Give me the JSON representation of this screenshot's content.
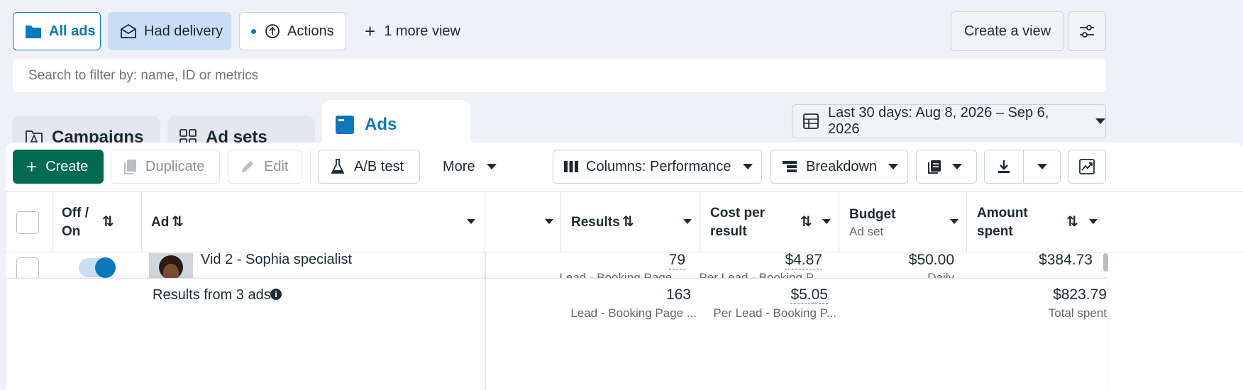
{
  "views": {
    "all_ads": "All ads",
    "had_delivery": "Had delivery",
    "actions": "Actions",
    "more_view": "1 more view",
    "create_view": "Create a view"
  },
  "search": {
    "placeholder": "Search to filter by: name, ID or metrics"
  },
  "tabs": {
    "campaigns": "Campaigns",
    "ad_sets": "Ad sets",
    "ads": "Ads"
  },
  "date_range": "Last 30 days: Aug 8, 2026 – Sep 6, 2026",
  "toolbar": {
    "create": "Create",
    "duplicate": "Duplicate",
    "edit": "Edit",
    "ab_test": "A/B test",
    "more": "More",
    "columns": "Columns: Performance",
    "breakdown": "Breakdown"
  },
  "table": {
    "headers": {
      "off_on": [
        "Off /",
        "On"
      ],
      "ad": "Ad",
      "results": "Results",
      "cost_per_result": [
        "Cost per",
        "result"
      ],
      "budget": "Budget",
      "budget_sub": "Ad set",
      "amount_spent": [
        "Amount",
        "spent"
      ]
    },
    "row": {
      "name": "Vid 2 - Sophia specialist",
      "results": "79",
      "results_sub": "Lead - Booking Page ...",
      "cost": "$4.87",
      "cost_sub": "Per Lead - Booking P...",
      "budget": "$50.00",
      "budget_sub": "Daily",
      "spent": "$384.73",
      "toggle_on": true
    },
    "summary": {
      "label": "Results from 3 ads",
      "results": "163",
      "results_sub": "Lead - Booking Page ...",
      "cost": "$5.05",
      "cost_sub": "Per Lead - Booking P...",
      "spent": "$823.79",
      "spent_sub": "Total spent"
    }
  },
  "colors": {
    "primary_green": "#006b4f",
    "accent_blue": "#0a78be",
    "selected_view": "#c9def5"
  }
}
